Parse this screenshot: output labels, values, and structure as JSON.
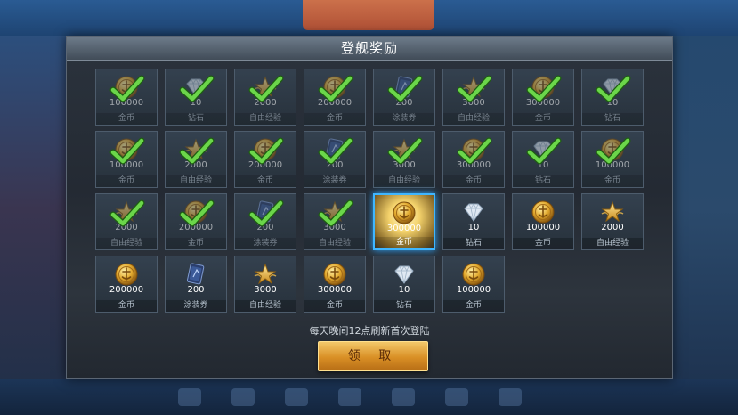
{
  "panel": {
    "title": "登舰奖励",
    "note": "每天晚间12点刷新首次登陆",
    "claim_label": "领 取"
  },
  "colors": {
    "check": "#6bd64a",
    "highlight": "#3fb6ff",
    "button": "#e0a03a"
  },
  "rewards": [
    {
      "icon": "gold-coin-icon",
      "amount": "100000",
      "name": "金币",
      "state": "claimed"
    },
    {
      "icon": "diamond-icon",
      "amount": "10",
      "name": "钻石",
      "state": "claimed"
    },
    {
      "icon": "gold-star-icon",
      "amount": "2000",
      "name": "自由经验",
      "state": "claimed"
    },
    {
      "icon": "gold-coin-icon",
      "amount": "200000",
      "name": "金币",
      "state": "claimed"
    },
    {
      "icon": "paint-voucher-icon",
      "amount": "200",
      "name": "涂装券",
      "state": "claimed"
    },
    {
      "icon": "gold-star-icon",
      "amount": "3000",
      "name": "自由经验",
      "state": "claimed"
    },
    {
      "icon": "gold-coin-icon",
      "amount": "300000",
      "name": "金币",
      "state": "claimed"
    },
    {
      "icon": "diamond-icon",
      "amount": "10",
      "name": "钻石",
      "state": "claimed"
    },
    {
      "icon": "gold-coin-icon",
      "amount": "100000",
      "name": "金币",
      "state": "claimed"
    },
    {
      "icon": "gold-star-icon",
      "amount": "2000",
      "name": "自由经验",
      "state": "claimed"
    },
    {
      "icon": "gold-coin-icon",
      "amount": "200000",
      "name": "金币",
      "state": "claimed"
    },
    {
      "icon": "paint-voucher-icon",
      "amount": "200",
      "name": "涂装券",
      "state": "claimed"
    },
    {
      "icon": "gold-star-icon",
      "amount": "3000",
      "name": "自由经验",
      "state": "claimed"
    },
    {
      "icon": "gold-coin-icon",
      "amount": "300000",
      "name": "金币",
      "state": "claimed"
    },
    {
      "icon": "diamond-icon",
      "amount": "10",
      "name": "钻石",
      "state": "claimed"
    },
    {
      "icon": "gold-coin-icon",
      "amount": "100000",
      "name": "金币",
      "state": "claimed"
    },
    {
      "icon": "gold-star-icon",
      "amount": "2000",
      "name": "自由经验",
      "state": "claimed"
    },
    {
      "icon": "gold-coin-icon",
      "amount": "200000",
      "name": "金币",
      "state": "claimed"
    },
    {
      "icon": "paint-voucher-icon",
      "amount": "200",
      "name": "涂装券",
      "state": "claimed"
    },
    {
      "icon": "gold-star-icon",
      "amount": "3000",
      "name": "自由经验",
      "state": "claimed"
    },
    {
      "icon": "gold-coin-icon",
      "amount": "300000",
      "name": "金币",
      "state": "current"
    },
    {
      "icon": "diamond-icon",
      "amount": "10",
      "name": "钻石",
      "state": "locked"
    },
    {
      "icon": "gold-coin-icon",
      "amount": "100000",
      "name": "金币",
      "state": "locked"
    },
    {
      "icon": "gold-star-icon",
      "amount": "2000",
      "name": "自由经验",
      "state": "locked"
    },
    {
      "icon": "gold-coin-icon",
      "amount": "200000",
      "name": "金币",
      "state": "locked"
    },
    {
      "icon": "paint-voucher-icon",
      "amount": "200",
      "name": "涂装券",
      "state": "locked"
    },
    {
      "icon": "gold-star-icon",
      "amount": "3000",
      "name": "自由经验",
      "state": "locked"
    },
    {
      "icon": "gold-coin-icon",
      "amount": "300000",
      "name": "金币",
      "state": "locked"
    },
    {
      "icon": "diamond-icon",
      "amount": "10",
      "name": "钻石",
      "state": "locked"
    },
    {
      "icon": "gold-coin-icon",
      "amount": "100000",
      "name": "金币",
      "state": "locked"
    }
  ]
}
